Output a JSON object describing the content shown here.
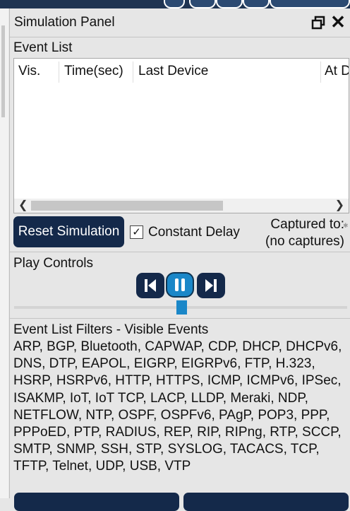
{
  "panel": {
    "title": "Simulation Panel"
  },
  "event_list": {
    "label": "Event List",
    "columns": [
      "Vis.",
      "Time(sec)",
      "Last Device",
      "At D"
    ],
    "rows": []
  },
  "controls": {
    "reset_label": "Reset Simulation",
    "constant_delay_label": "Constant Delay",
    "constant_delay_checked": true,
    "captured_line1": "Captured to:",
    "captured_line2": "(no captures)"
  },
  "play_controls": {
    "label": "Play Controls",
    "state": "playing"
  },
  "filters": {
    "title": "Event List Filters - Visible Events",
    "visible_events": "ARP, BGP, Bluetooth, CAPWAP, CDP, DHCP, DHCPv6, DNS, DTP, EAPOL, EIGRP, EIGRPv6, FTP, H.323, HSRP, HSRPv6, HTTP, HTTPS, ICMP, ICMPv6, IPSec, ISAKMP, IoT, IoT TCP, LACP, LLDP, Meraki, NDP, NETFLOW, NTP, OSPF, OSPFv6, PAgP, POP3, PPP, PPPoED, PTP, RADIUS, REP, RIP, RIPng, RTP, SCCP, SMTP, SNMP, SSH, STP, SYSLOG, TACACS, TCP, TFTP, Telnet, UDP, USB, VTP"
  },
  "colors": {
    "button_navy": "#14294a",
    "accent_blue": "#1a87c8",
    "panel_bg": "#e6e6e6"
  },
  "icons": [
    "restore-icon",
    "close-icon",
    "step-back-icon",
    "pause-icon",
    "step-forward-icon",
    "check-icon",
    "chevron-left-icon",
    "chevron-right-icon"
  ]
}
